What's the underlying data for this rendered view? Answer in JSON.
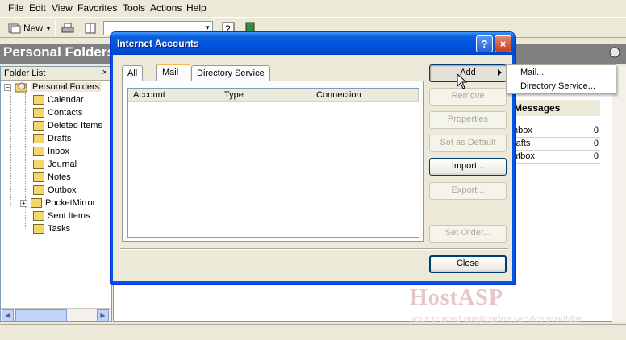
{
  "menubar": {
    "items": [
      {
        "label": "File"
      },
      {
        "label": "Edit"
      },
      {
        "label": "View"
      },
      {
        "label": "Favorites"
      },
      {
        "label": "Tools"
      },
      {
        "label": "Actions"
      },
      {
        "label": "Help"
      }
    ]
  },
  "toolbar": {
    "new_label": "New"
  },
  "outlook": {
    "pane_title": "Personal Folders",
    "folder_list_title": "Folder List",
    "folder_list_close": "×",
    "tree_root": "Personal Folders",
    "folders": [
      "Calendar",
      "Contacts",
      "Deleted Items",
      "Drafts",
      "Inbox",
      "Journal",
      "Notes",
      "Outbox",
      "PocketMirror",
      "Sent Items",
      "Tasks"
    ]
  },
  "messages": {
    "title": "Messages",
    "rows": [
      {
        "name": "nbox",
        "count": "0"
      },
      {
        "name": "rafts",
        "count": "0"
      },
      {
        "name": "utbox",
        "count": "0"
      }
    ]
  },
  "dialog": {
    "title": "Internet Accounts",
    "help_btn": "?",
    "close_btn": "×",
    "tabs": [
      {
        "label": "All",
        "active": false
      },
      {
        "label": "Mail",
        "active": true
      },
      {
        "label": "Directory Service",
        "active": false
      }
    ],
    "columns": [
      "Account",
      "Type",
      "Connection"
    ],
    "buttons": {
      "add": "Add",
      "remove": "Remove",
      "properties": "Properties",
      "set_default": "Set as Default",
      "import": "Import...",
      "export": "Export...",
      "set_order": "Set Order...",
      "close": "Close"
    }
  },
  "submenu": {
    "items": [
      "Mail...",
      "Directory Service..."
    ]
  },
  "watermark": {
    "title": "HostASP",
    "subtitle": "your trusted application service provider"
  },
  "colors": {
    "titlebar": "#0055e5",
    "pane_header": "#808080",
    "accent_tab": "#f7b94b"
  }
}
